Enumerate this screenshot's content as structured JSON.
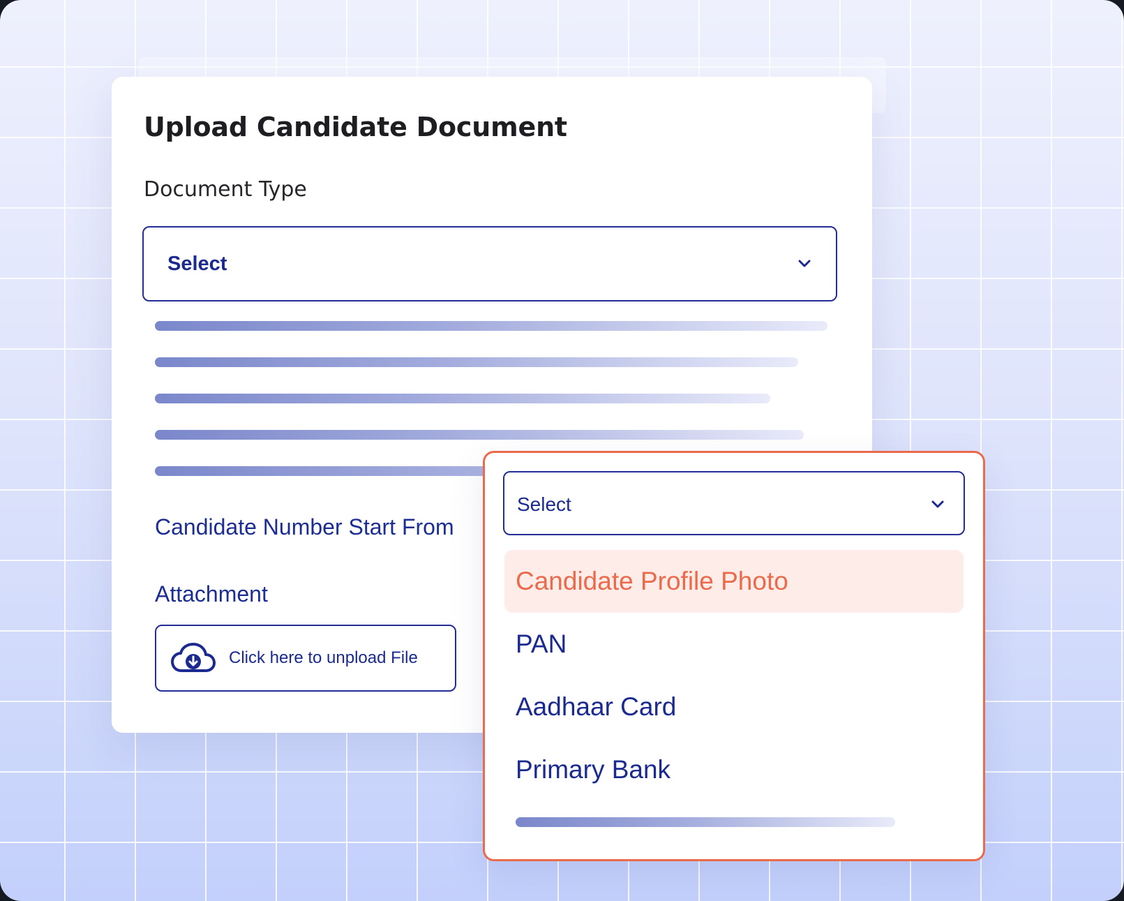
{
  "card": {
    "title": "Upload Candidate Document",
    "document_type_label": "Document Type",
    "document_type_select": {
      "value": "Select"
    },
    "candidate_number_label": "Candidate Number Start From",
    "attachment_label": "Attachment",
    "upload_button_label": "Click here to unpload File"
  },
  "dropdown": {
    "select_value": "Select",
    "options": [
      {
        "label": "Candidate Profile Photo",
        "selected": true
      },
      {
        "label": "PAN",
        "selected": false
      },
      {
        "label": "Aadhaar Card",
        "selected": false
      },
      {
        "label": "Primary Bank",
        "selected": false
      }
    ]
  },
  "icons": {
    "select_chevron": "chevron-down-icon",
    "upload": "cloud-download-icon"
  },
  "colors": {
    "primary": "#1b2a8f",
    "accent": "#ec6a4c",
    "selected_bg": "#feece8"
  }
}
